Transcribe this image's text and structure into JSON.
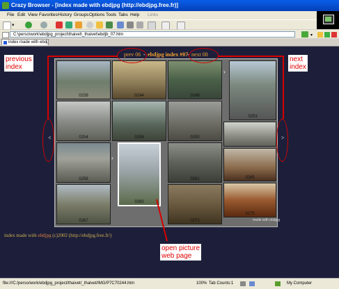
{
  "window": {
    "title": "Crazy Browser - [index made with ebdjpg (http://ebdjpg.free.fr)]"
  },
  "menu": [
    "File",
    "Edit",
    "View",
    "Favorites",
    "History",
    "Groups",
    "Options",
    "Tools",
    "Tabs",
    "Help",
    "Links"
  ],
  "address": {
    "value": "C:\\perso\\work\\ebdjpg_project\\thaivet\\_thaivet\\ebdjb_07.htm"
  },
  "tab": {
    "label": "index made with ebdj..."
  },
  "page": {
    "nav_prev": "prev",
    "nav_prev_num": "06",
    "nav_title": "ebdjpg index #07",
    "nav_next": "next",
    "nav_next_num": "08",
    "left_arrow": "<",
    "right_arrow": ">",
    "footer_prefix": "index made with",
    "footer_link": "ebdjpg",
    "footer_suffix": "(c)2002 (http://ebdjpg.free.fr/)",
    "thumb_numbers": [
      "0239",
      "0244",
      "0248",
      "0253",
      "0254",
      "0256",
      "0250",
      "0258",
      "0260",
      "0261",
      "0265",
      "0267",
      "0272",
      "0275"
    ],
    "made_with": "made with ebdjpg"
  },
  "annotations": {
    "previous_index": [
      "previous",
      "index"
    ],
    "next_index": [
      "next",
      "index"
    ],
    "open_picture": [
      "open  picture",
      "web page"
    ]
  },
  "status": {
    "url": "file:///C:/perso/work/ebdjpg_project/thaivet/_thaivet/IMG/P7C70244.htm",
    "zoom": "100%",
    "tab_counts": "Tab Counts:1",
    "zone": "My Computer"
  }
}
